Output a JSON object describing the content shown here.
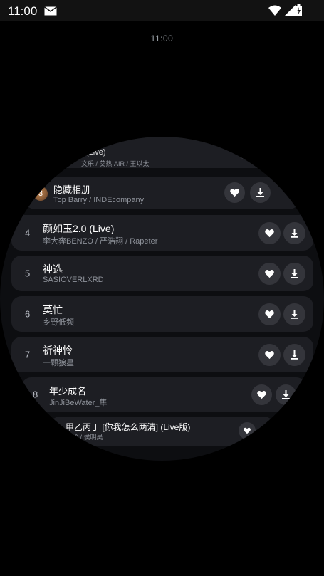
{
  "status_bar": {
    "time": "11:00",
    "icons": [
      "mail-icon",
      "wifi-icon",
      "signal-icon",
      "battery-charging-icon"
    ]
  },
  "watch_time": "11:00",
  "songs": [
    {
      "num": "",
      "title": "(Live)",
      "artist": "文乐 / 艾热 AIR / 王以太"
    },
    {
      "num": "3",
      "title": "隐藏相册",
      "artist": "Top Barry / INDEcompany"
    },
    {
      "num": "4",
      "title": "颜如玉2.0 (Live)",
      "artist": "李大奔BENZO / 严浩翔 / Rapeter"
    },
    {
      "num": "5",
      "title": "神选",
      "artist": "SASIOVERLXRD"
    },
    {
      "num": "6",
      "title": "莫忙",
      "artist": "乡野低频"
    },
    {
      "num": "7",
      "title": "祈神怜",
      "artist": "一颗狼星"
    },
    {
      "num": "8",
      "title": "年少成名",
      "artist": "JinJiBeWater_隼"
    },
    {
      "num": "",
      "title": "甲乙丙丁 [你我怎么两清] (Live版)",
      "artist": "鹿晗 / 侯明昊"
    }
  ],
  "button_icons": {
    "like": "heart-icon",
    "download": "download-icon"
  },
  "colors": {
    "background": "#000000",
    "row": "#1d1e23",
    "button": "#34353b",
    "secondary_text": "#8d9199"
  }
}
